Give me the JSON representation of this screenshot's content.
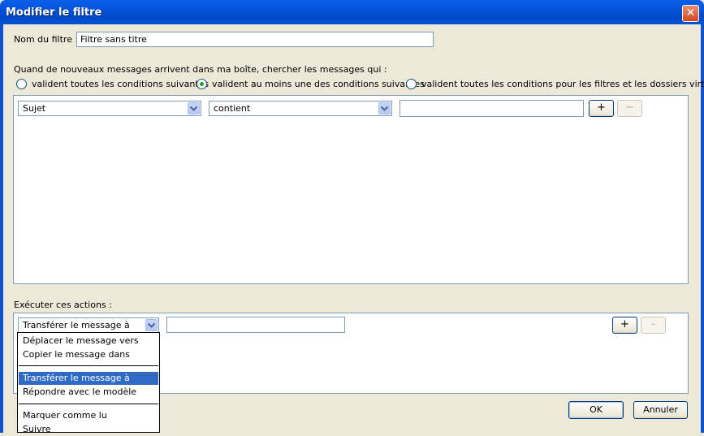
{
  "window": {
    "title": "Modifier le filtre",
    "close_glyph": "✕"
  },
  "filter_name": {
    "label": "Nom du filtre :",
    "value": "Filtre sans titre"
  },
  "match": {
    "prompt": "Quand de nouveaux messages arrivent dans ma boîte, chercher les messages qui :",
    "options": [
      {
        "label": "valident toutes les conditions suivantes",
        "checked": false
      },
      {
        "label": "valident au moins une des conditions suivantes",
        "checked": true
      },
      {
        "label": "valident toutes les conditions pour les filtres et les dossiers virtuels",
        "checked": false
      }
    ]
  },
  "condition": {
    "field": "Sujet",
    "operator": "contient",
    "value": "",
    "add_label": "+",
    "remove_label": "−"
  },
  "actions": {
    "label": "Exécuter ces actions :",
    "action_selected": "Transférer le message à",
    "action_value": "",
    "add_label": "+",
    "remove_label": "-",
    "dropdown_items": [
      "Déplacer le message vers",
      "Copier le message dans",
      "Transférer le message à",
      "Répondre avec le modèle",
      "Marquer comme lu",
      "Suivre"
    ],
    "dropdown_selected": "Transférer le message à"
  },
  "buttons": {
    "ok": "OK",
    "cancel": "Annuler"
  },
  "colors": {
    "titlebar": "#0453d9",
    "dialog_bg": "#ece9d8",
    "selection": "#316ac5",
    "radio_checked": "#21a121"
  }
}
